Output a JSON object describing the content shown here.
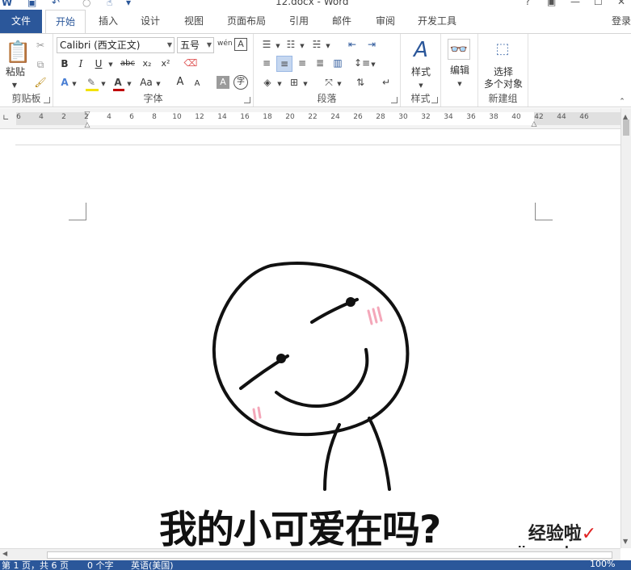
{
  "window": {
    "title": "12.docx - Word",
    "controls": [
      "?",
      "▣",
      "—",
      "☐",
      "✕"
    ]
  },
  "tabs": [
    {
      "id": "file",
      "label": "文件"
    },
    {
      "id": "home",
      "label": "开始"
    },
    {
      "id": "insert",
      "label": "插入"
    },
    {
      "id": "design",
      "label": "设计"
    },
    {
      "id": "view",
      "label": "视图"
    },
    {
      "id": "layout",
      "label": "页面布局"
    },
    {
      "id": "references",
      "label": "引用"
    },
    {
      "id": "mailings",
      "label": "邮件"
    },
    {
      "id": "review",
      "label": "审阅"
    },
    {
      "id": "developer",
      "label": "开发工具"
    }
  ],
  "login_label": "登录",
  "ribbon": {
    "clipboard": {
      "label": "剪贴板",
      "paste_label": "粘贴"
    },
    "font": {
      "label": "字体",
      "font_name": "Calibri (西文正文)",
      "font_size": "五号",
      "wen_icon": "wén",
      "a_icon": "A",
      "bold": "B",
      "italic": "I",
      "underline": "U",
      "strike": "abc",
      "sub": "x₂",
      "sup": "x²",
      "grow": "A",
      "shrink": "A",
      "aa": "Aa",
      "zi": "字"
    },
    "paragraph": {
      "label": "段落"
    },
    "styles": {
      "label": "样式",
      "button_label": "样式"
    },
    "editing": {
      "button_label": "编辑"
    },
    "newgroup": {
      "label": "新建组",
      "button_label_1": "选择",
      "button_label_2": "多个对象"
    }
  },
  "ruler": {
    "labels": [
      "6",
      "4",
      "2",
      "2",
      "4",
      "6",
      "8",
      "10",
      "12",
      "14",
      "16",
      "18",
      "20",
      "22",
      "24",
      "26",
      "28",
      "30",
      "32",
      "34",
      "36",
      "38",
      "40",
      "42",
      "44",
      "46"
    ]
  },
  "document": {
    "caption": "我的小可爱在吗?"
  },
  "watermark": {
    "text": "经验啦",
    "url": "jingyanla.com",
    "check": "✓"
  },
  "statusbar": {
    "page": "第 1 页，共 6 页",
    "words": "0 个字",
    "language": "英语(美国)",
    "zoom": "100%"
  },
  "colors": {
    "accent": "#2b579a",
    "blush": "#f4a7b9"
  }
}
